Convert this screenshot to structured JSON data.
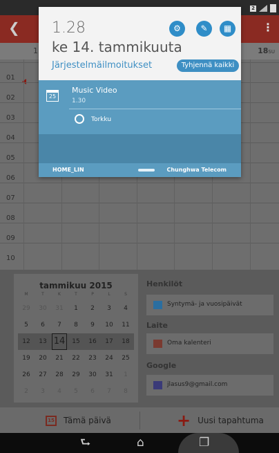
{
  "status_bar": {
    "sim_badge": "2"
  },
  "calendar_app": {
    "day_header_left": "1",
    "day_header_right": "18",
    "day_header_right_suffix": "SU",
    "hours": [
      "01",
      "02",
      "03",
      "04",
      "05",
      "06",
      "07",
      "08",
      "09",
      "10"
    ],
    "mini_calendar": {
      "title": "tammikuu 2015",
      "weekdays": [
        "M",
        "T",
        "K",
        "T",
        "P",
        "L",
        "S"
      ],
      "weeks": [
        [
          {
            "d": "29",
            "dim": true
          },
          {
            "d": "30",
            "dim": true
          },
          {
            "d": "31",
            "dim": true
          },
          {
            "d": "1"
          },
          {
            "d": "2"
          },
          {
            "d": "3"
          },
          {
            "d": "4"
          }
        ],
        [
          {
            "d": "5"
          },
          {
            "d": "6"
          },
          {
            "d": "7"
          },
          {
            "d": "8"
          },
          {
            "d": "9"
          },
          {
            "d": "10"
          },
          {
            "d": "11"
          }
        ],
        [
          {
            "d": "12"
          },
          {
            "d": "13"
          },
          {
            "d": "14",
            "today": true
          },
          {
            "d": "15"
          },
          {
            "d": "16"
          },
          {
            "d": "17"
          },
          {
            "d": "18"
          }
        ],
        [
          {
            "d": "19"
          },
          {
            "d": "20"
          },
          {
            "d": "21"
          },
          {
            "d": "22"
          },
          {
            "d": "23"
          },
          {
            "d": "24"
          },
          {
            "d": "25"
          }
        ],
        [
          {
            "d": "26"
          },
          {
            "d": "27"
          },
          {
            "d": "28"
          },
          {
            "d": "29"
          },
          {
            "d": "30"
          },
          {
            "d": "31"
          },
          {
            "d": "1",
            "dim": true
          }
        ],
        [
          {
            "d": "2",
            "dim": true
          },
          {
            "d": "3",
            "dim": true
          },
          {
            "d": "4",
            "dim": true
          },
          {
            "d": "5",
            "dim": true
          },
          {
            "d": "6",
            "dim": true
          },
          {
            "d": "7",
            "dim": true
          },
          {
            "d": "8",
            "dim": true
          }
        ]
      ]
    },
    "sections": {
      "people": {
        "title": "Henkilöt",
        "item": "Syntymä- ja vuosipäivät",
        "color": "#2a6ea0"
      },
      "device": {
        "title": "Laite",
        "item": "Oma kalenteri",
        "color": "#7a3a30"
      },
      "google": {
        "title": "Google",
        "item": "jlasus9@gmail.com",
        "color": "#3a3a78"
      }
    },
    "actions": {
      "today_icon_text": "15",
      "today": "Tämä päivä",
      "new_event": "Uusi tapahtuma"
    }
  },
  "notification_shade": {
    "time": "1.28",
    "date": "ke 14. tammikuuta",
    "system_notifications": "Järjestelmäilmoitukset",
    "clear_all": "Tyhjennä kaikki",
    "notification": {
      "app_icon_text": "25",
      "title": "Music Video",
      "time": "1.30",
      "snooze": "Torkku"
    },
    "carrier_left": "HOME_LIN",
    "carrier_right": "Chunghwa Telecom"
  },
  "colors": {
    "accent": "#2f8dc8",
    "notification_bg": "#5b9cc0",
    "calendar_red": "#8a1a12"
  },
  "icons": {
    "settings": "gear-icon",
    "edit": "edit-icon",
    "grid": "grid-icon",
    "snooze": "alarm-clock-icon",
    "back": "back-icon",
    "home": "home-icon",
    "recents": "recents-icon"
  }
}
